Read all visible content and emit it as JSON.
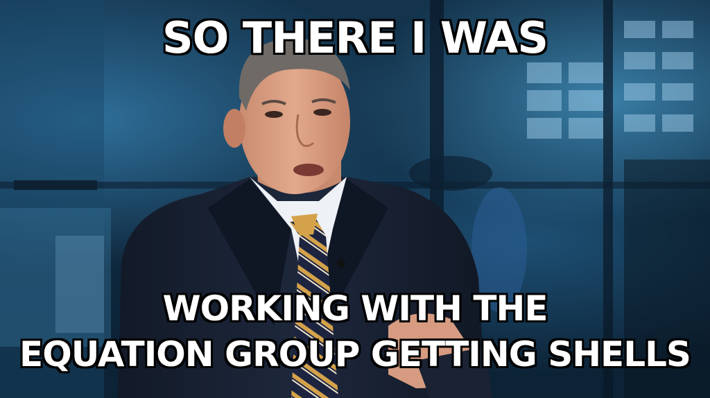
{
  "meme": {
    "top_text": "SO THERE I WAS",
    "bottom_text_line1": "WORKING WITH THE",
    "bottom_text_line2": "EQUATION GROUP GETTING SHELLS"
  },
  "colors": {
    "caption_fill": "#ffffff",
    "caption_outline": "#000000",
    "background_blue": "#14344d",
    "suit": "#1a2233",
    "shirt": "#eef1f6",
    "tie_stripe_gold": "#d4a24a",
    "tie_stripe_navy": "#1c2440"
  }
}
